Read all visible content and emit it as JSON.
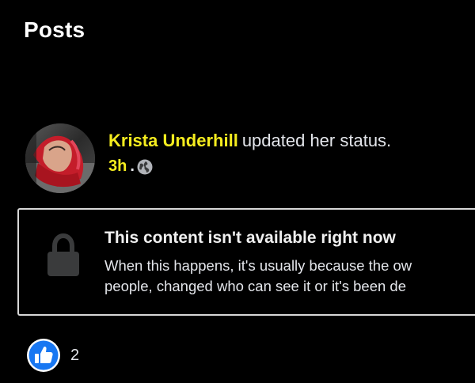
{
  "section": {
    "title": "Posts"
  },
  "post": {
    "author": "Krista Underhill",
    "action": "updated her status.",
    "time": "3h",
    "separator": ".",
    "privacy_icon": "globe-icon",
    "avatar_icon": "profile-photo",
    "unavailable": {
      "icon": "lock-icon",
      "title": "This content isn't available right now",
      "body_line1": "When this happens, it's usually because the ow",
      "body_line2": "people, changed who can see it or it's been de"
    },
    "reactions": {
      "icon": "like-icon",
      "count": "2"
    }
  },
  "colors": {
    "background": "#000000",
    "accent_yellow": "#f5ec1f",
    "text": "#e4e6eb",
    "like_blue": "#1877f2",
    "box_border": "#d8d8d8"
  }
}
